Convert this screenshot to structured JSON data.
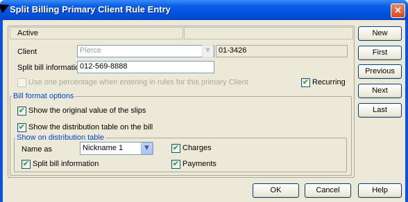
{
  "window": {
    "title": "Split Billing Primary Client Rule Entry",
    "close_glyph": "×"
  },
  "header": {
    "status": "Active"
  },
  "client": {
    "label": "Client",
    "name_value": "Pierce",
    "number_value": "01-3426"
  },
  "split_bill": {
    "label": "Split bill information",
    "value": "012-569-8888"
  },
  "options": {
    "use_percentage_label": "Use one percentage when entering in rules for this primary Client",
    "use_percentage_checked": false,
    "recurring_label": "Recurring",
    "recurring_checked": true
  },
  "bill_format": {
    "group_title": "Bill format options",
    "show_original_label": "Show the original value of the slips",
    "show_original_checked": true,
    "show_distribution_label": "Show the distribution table on the bill",
    "show_distribution_checked": true
  },
  "distribution": {
    "group_title": "Show on distribution table",
    "name_as_label": "Name as",
    "name_as_value": "Nickname 1",
    "charges_label": "Charges",
    "charges_checked": true,
    "payments_label": "Payments",
    "payments_checked": true,
    "split_info_label": "Split bill information",
    "split_info_checked": true
  },
  "side_buttons": {
    "new": "New",
    "first": "First",
    "previous": "Previous",
    "next": "Next",
    "last": "Last"
  },
  "footer_buttons": {
    "ok": "OK",
    "cancel": "Cancel",
    "help": "Help"
  },
  "check_glyph": "✔",
  "dropdown_glyph": "▼",
  "colors": {
    "titlebar": "#0050dc",
    "group_title": "#0046d5",
    "check": "#21a121"
  }
}
